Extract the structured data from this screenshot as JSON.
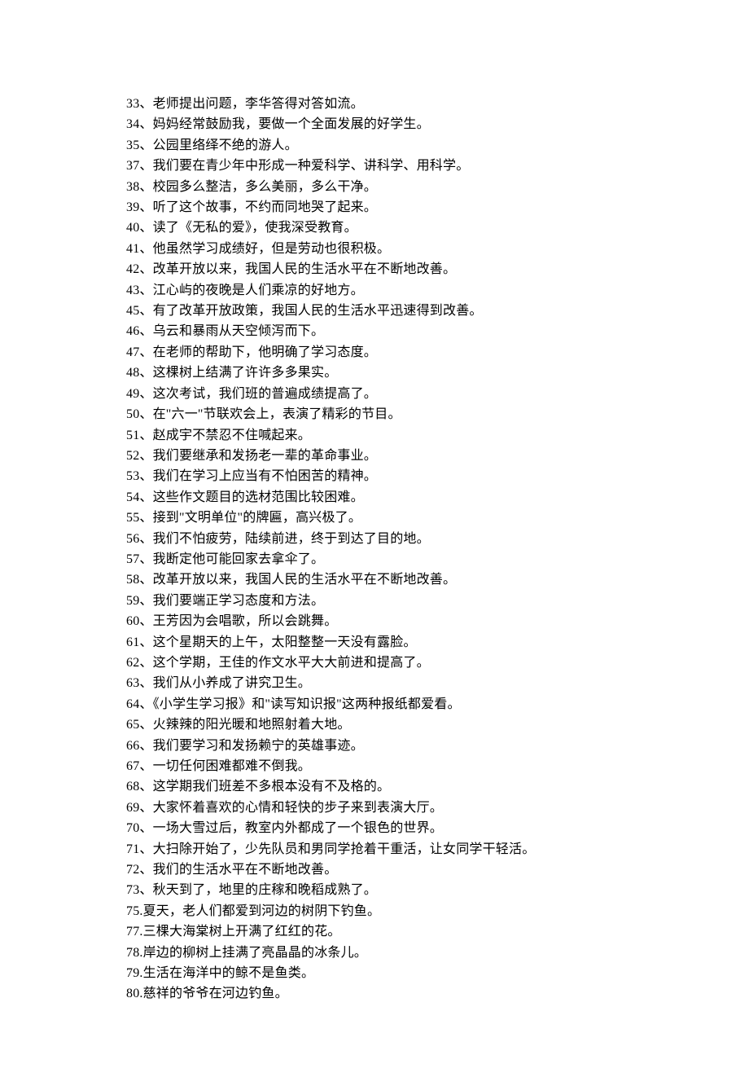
{
  "lines": [
    "33、老师提出问题，李华答得对答如流。",
    "34、妈妈经常鼓励我，要做一个全面发展的好学生。",
    "35、公园里络绎不绝的游人。",
    "37、我们要在青少年中形成一种爱科学、讲科学、用科学。",
    "38、校园多么整洁，多么美丽，多么干净。",
    "39、听了这个故事，不约而同地哭了起来。",
    "40、读了《无私的爱》，使我深受教育。",
    "41、他虽然学习成绩好，但是劳动也很积极。",
    "42、改革开放以来，我国人民的生活水平在不断地改善。",
    "43、江心屿的夜晚是人们乘凉的好地方。",
    "45、有了改革开放政策，我国人民的生活水平迅速得到改善。",
    "46、乌云和暴雨从天空倾泻而下。",
    "47、在老师的帮助下，他明确了学习态度。",
    "48、这棵树上结满了许许多多果实。",
    "49、这次考试，我们班的普遍成绩提高了。",
    "50、在\"六一\"节联欢会上，表演了精彩的节目。",
    "51、赵成宇不禁忍不住喊起来。",
    "52、我们要继承和发扬老一辈的革命事业。",
    "53、我们在学习上应当有不怕困苦的精神。",
    "54、这些作文题目的选材范围比较困难。",
    "55、接到\"文明单位\"的牌匾，高兴极了。",
    "56、我们不怕疲劳，陆续前进，终于到达了目的地。",
    "57、我断定他可能回家去拿伞了。",
    "58、改革开放以来，我国人民的生活水平在不断地改善。",
    "59、我们要端正学习态度和方法。",
    "60、王芳因为会唱歌，所以会跳舞。",
    "61、这个星期天的上午，太阳整整一天没有露脸。",
    "62、这个学期，王佳的作文水平大大前进和提高了。",
    "63、我们从小养成了讲究卫生。",
    "64、《小学生学习报》和\"读写知识报\"这两种报纸都爱看。",
    "65、火辣辣的阳光暖和地照射着大地。",
    "66、我们要学习和发扬赖宁的英雄事迹。",
    "67、一切任何困难都难不倒我。",
    "68、这学期我们班差不多根本没有不及格的。",
    "69、大家怀着喜欢的心情和轻快的步子来到表演大厅。",
    "70、一场大雪过后，教室内外都成了一个银色的世界。",
    "71、大扫除开始了，少先队员和男同学抢着干重活，让女同学干轻活。",
    "72、我们的生活水平在不断地改善。",
    "73、秋天到了，地里的庄稼和晚稻成熟了。",
    "75.夏天，老人们都爱到河边的树阴下钓鱼。",
    "77.三棵大海棠树上开满了红红的花。",
    "78.岸边的柳树上挂满了亮晶晶的冰条儿。",
    "79.生活在海洋中的鲸不是鱼类。",
    "80.慈祥的爷爷在河边钓鱼。"
  ]
}
